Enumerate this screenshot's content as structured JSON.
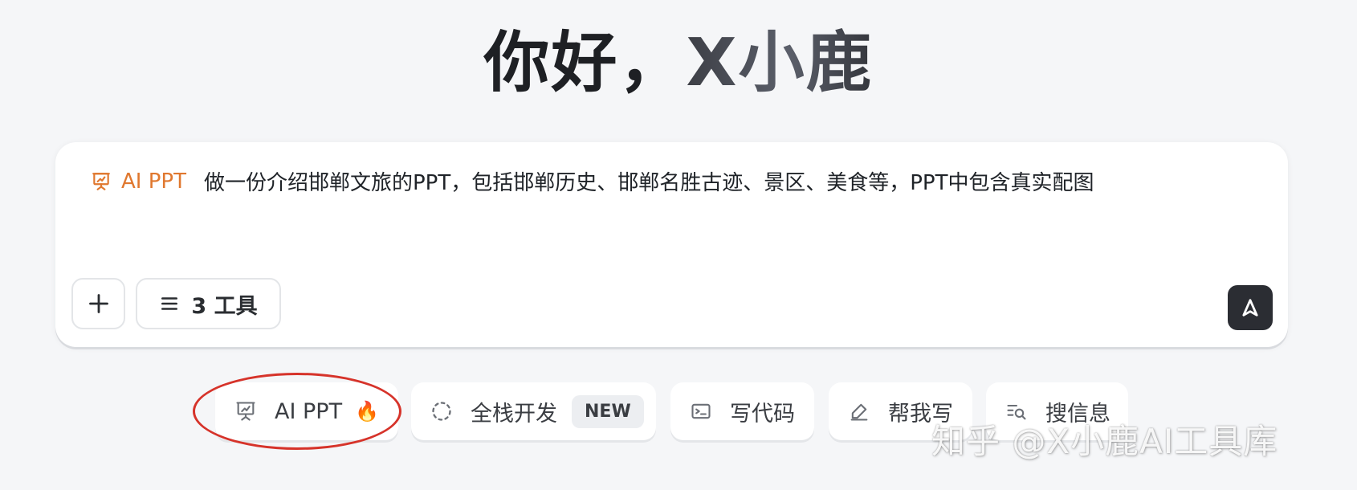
{
  "greeting": {
    "hello": "你好，",
    "name": "X小鹿"
  },
  "composer": {
    "mode_tag": "AI PPT",
    "prompt": "做一份介绍邯郸文旅的PPT，包括邯郸历史、邯郸名胜古迹、景区、美食等，PPT中包含真实配图",
    "tools_label": "3 工具",
    "icons": {
      "mode": "presentation-icon",
      "plus": "plus-icon",
      "tools": "list-icon",
      "send": "send-arrow-icon"
    }
  },
  "suggestions": [
    {
      "label": "AI PPT",
      "icon": "presentation-icon",
      "emoji": "🔥"
    },
    {
      "label": "全栈开发",
      "icon": "dotted-circle-icon",
      "badge": "NEW"
    },
    {
      "label": "写代码",
      "icon": "terminal-icon"
    },
    {
      "label": "帮我写",
      "icon": "pencil-icon"
    },
    {
      "label": "搜信息",
      "icon": "search-icon"
    }
  ],
  "watermark": "知乎 @X小鹿AI工具库",
  "colors": {
    "accent_orange": "#e0782f",
    "annotation_red": "#d6332a",
    "send_button": "#2b2d33",
    "background": "#f5f6f8"
  }
}
